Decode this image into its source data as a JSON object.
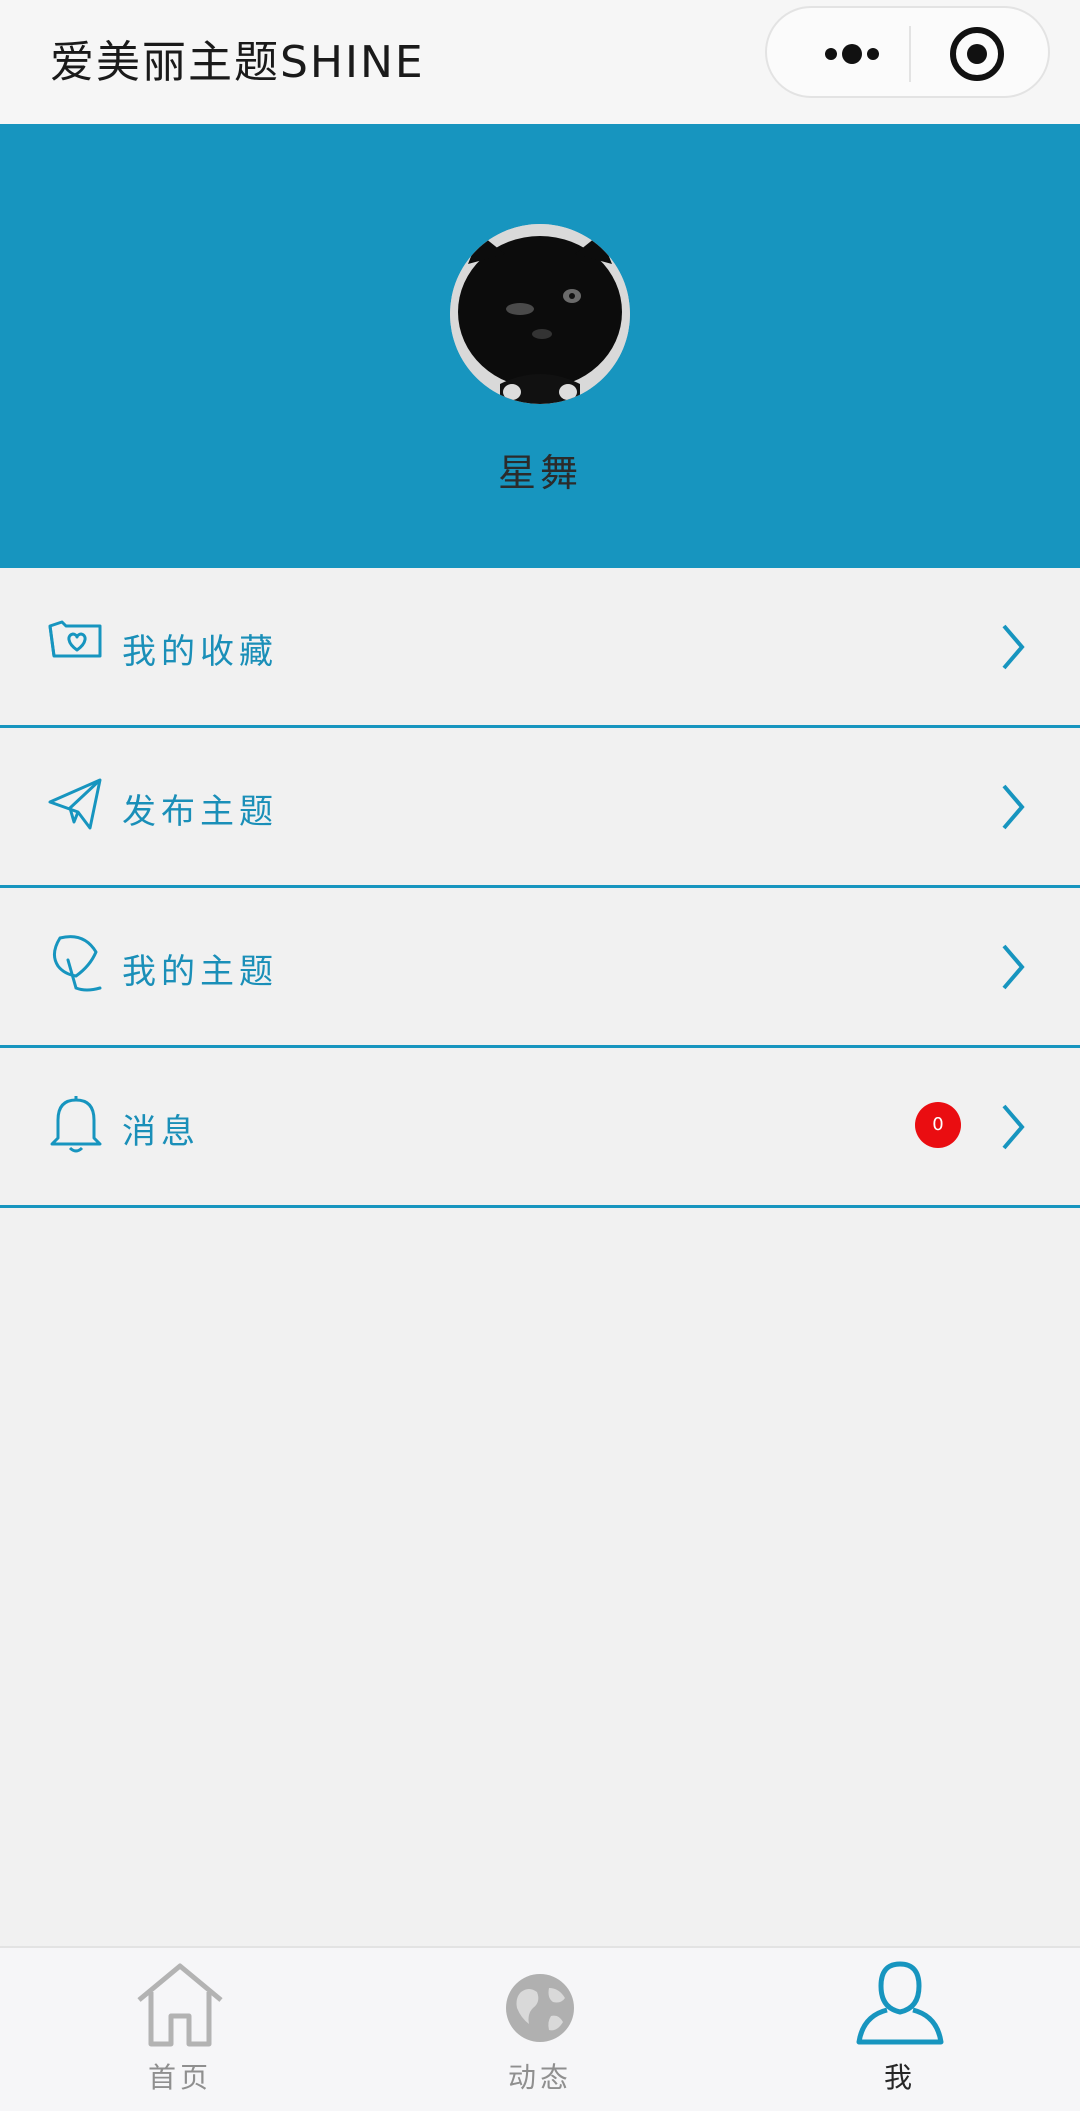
{
  "navbar": {
    "title": "爱美丽主题SHINE",
    "more_icon": "more-dots-icon",
    "close_icon": "target-close-icon"
  },
  "profile": {
    "username": "星舞",
    "background_color": "#1795bf",
    "avatar_icon": "avatar-image"
  },
  "menu": {
    "accent_color": "#1795bf",
    "items": [
      {
        "label": "我的收藏",
        "icon": "favorites-folder-heart-icon"
      },
      {
        "label": "发布主题",
        "icon": "paper-plane-icon"
      },
      {
        "label": "我的主题",
        "icon": "feather-quill-icon"
      },
      {
        "label": "消息",
        "icon": "bell-icon",
        "badge": "0"
      }
    ]
  },
  "tabbar": {
    "tabs": [
      {
        "label": "首页",
        "icon": "home-icon",
        "active": false
      },
      {
        "label": "动态",
        "icon": "globe-icon",
        "active": false
      },
      {
        "label": "我",
        "icon": "user-icon",
        "active": true
      }
    ]
  }
}
